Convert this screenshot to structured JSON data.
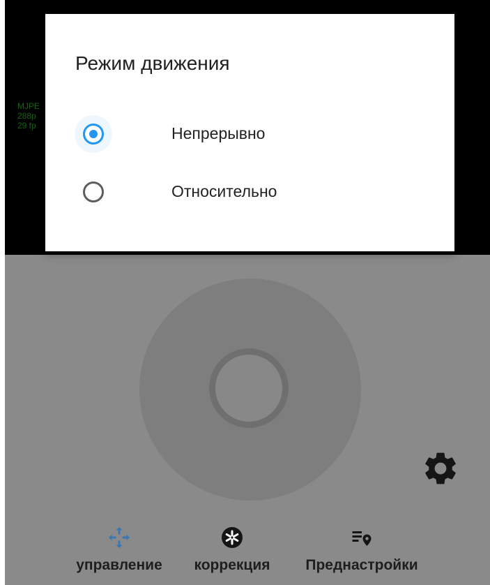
{
  "dialog": {
    "title": "Режим движения",
    "options": [
      {
        "label": "Непрерывно",
        "selected": true
      },
      {
        "label": "Относительно",
        "selected": false
      }
    ]
  },
  "video_overlay": {
    "line1": "MJPE",
    "line2": "288p",
    "line3": "29 fp"
  },
  "bottom_nav": [
    {
      "label": "управление",
      "icon": "move-arrows-icon",
      "active": true
    },
    {
      "label": "коррекция",
      "icon": "aperture-icon",
      "active": false
    },
    {
      "label": "Преднастройки",
      "icon": "list-location-icon",
      "active": false
    }
  ],
  "colors": {
    "accent": "#2196f3",
    "panel": "#8a8a8a"
  }
}
